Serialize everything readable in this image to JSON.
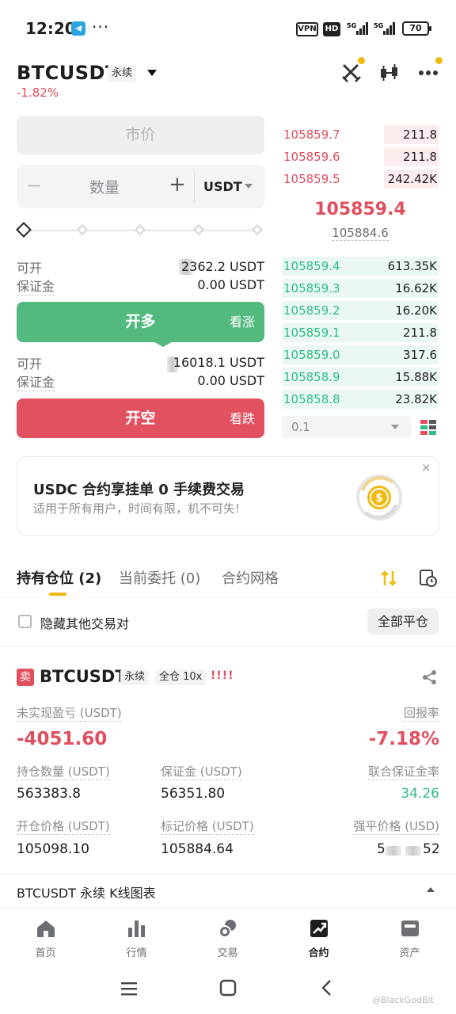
{
  "status_bar": {
    "time": "12:20",
    "dots": "···",
    "vpn": "VPN",
    "hd": "HD",
    "battery": "70"
  },
  "header": {
    "symbol": "BTCUSDT",
    "perp_tag": "永续",
    "change": "-1.82%"
  },
  "order_form": {
    "market_label": "市价",
    "qty_minus": "−",
    "qty_label": "数量",
    "qty_plus": "+",
    "qty_unit": "USDT",
    "long": {
      "avail_label": "可开",
      "avail_value": "2362.2 USDT",
      "margin_label": "保证金",
      "margin_value": "0.00 USDT",
      "button": "开多",
      "button_sub": "看涨"
    },
    "short": {
      "avail_label": "可开",
      "avail_value": "16018.1 USDT",
      "margin_label": "保证金",
      "margin_value": "0.00 USDT",
      "button": "开空",
      "button_sub": "看跌"
    },
    "slider_percent": 0
  },
  "order_book": {
    "asks": [
      {
        "price": "105859.7",
        "qty": "211.8",
        "depth": 0.35
      },
      {
        "price": "105859.6",
        "qty": "211.8",
        "depth": 0.35
      },
      {
        "price": "105859.5",
        "qty": "242.42K",
        "depth": 0.35
      }
    ],
    "last_price": "105859.4",
    "mark_price": "105884.6",
    "bids": [
      {
        "price": "105859.4",
        "qty": "613.35K",
        "depth": 1.0
      },
      {
        "price": "105859.3",
        "qty": "16.62K",
        "depth": 1.0
      },
      {
        "price": "105859.2",
        "qty": "16.20K",
        "depth": 1.0
      },
      {
        "price": "105859.1",
        "qty": "211.8",
        "depth": 1.0
      },
      {
        "price": "105859.0",
        "qty": "317.6",
        "depth": 1.0
      },
      {
        "price": "105858.9",
        "qty": "15.88K",
        "depth": 1.0
      },
      {
        "price": "105858.8",
        "qty": "23.82K",
        "depth": 1.0
      }
    ],
    "depth_step": "0.1"
  },
  "promo": {
    "title": "USDC 合约享挂单 0 手续费交易",
    "subtitle": "适用于所有用户，时间有限，机不可失!",
    "close": "×"
  },
  "tabs": {
    "positions": "持有仓位 (2)",
    "orders": "当前委托 (0)",
    "grid": "合约网格"
  },
  "filter": {
    "hide_label": "隐藏其他交易对",
    "close_all": "全部平仓"
  },
  "position": {
    "side_tag": "卖",
    "symbol": "BTCUSDT",
    "perp": "永续",
    "margin_mode": "全仓 10x",
    "risk_bars": "!!!!",
    "unrealized_label": "未实现盈亏 (USDT)",
    "unrealized_value": "-4051.60",
    "roe_label": "回报率",
    "roe_value": "-7.18%",
    "size_label": "持仓数量 (USDT)",
    "size_value": "563383.8",
    "margin_label": "保证金 (USDT)",
    "margin_value": "56351.80",
    "margin_ratio_label": "联合保证金率",
    "margin_ratio_value": "34.26",
    "entry_label": "开仓价格 (USDT)",
    "entry_value": "105098.10",
    "mark_label": "标记价格 (USDT)",
    "mark_value": "105884.64",
    "liq_label": "强平价格 (USD)",
    "liq_value_start": "5",
    "liq_value_end": "52"
  },
  "chart_strip": {
    "label": "BTCUSDT 永续 K线图表"
  },
  "bottom_nav": [
    {
      "label": "首页",
      "icon": "home-icon"
    },
    {
      "label": "行情",
      "icon": "markets-icon"
    },
    {
      "label": "交易",
      "icon": "trade-icon"
    },
    {
      "label": "合约",
      "icon": "futures-icon",
      "active": true
    },
    {
      "label": "资产",
      "icon": "wallet-icon"
    }
  ],
  "watermark": "@BlackGodBit",
  "colors": {
    "up": "#2ebd85",
    "down": "#e04f5e",
    "accent": "#f0b90b"
  }
}
